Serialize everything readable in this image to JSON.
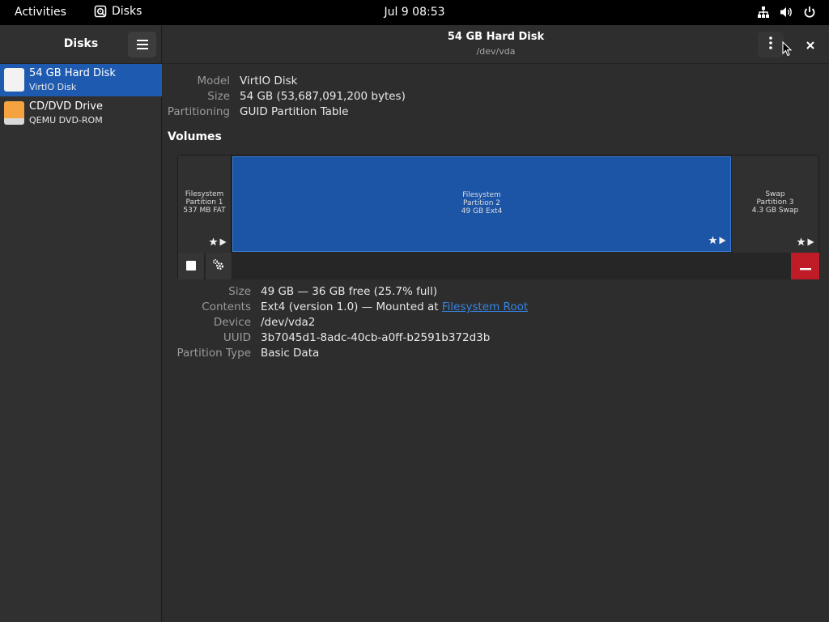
{
  "topbar": {
    "activities": "Activities",
    "app_name": "Disks",
    "clock": "Jul 9  08:53"
  },
  "sidebar": {
    "title": "Disks",
    "items": [
      {
        "name": "54 GB Hard Disk",
        "sub": "VirtIO Disk",
        "icon": "hard-disk-icon",
        "selected": true
      },
      {
        "name": "CD/DVD Drive",
        "sub": "QEMU DVD-ROM",
        "icon": "optical-drive-icon",
        "selected": false
      }
    ]
  },
  "header": {
    "title": "54 GB Hard Disk",
    "subtitle": "/dev/vda"
  },
  "drive_props": {
    "model_label": "Model",
    "model": "VirtIO Disk",
    "size_label": "Size",
    "size": "54 GB (53,687,091,200 bytes)",
    "partitioning_label": "Partitioning",
    "partitioning": "GUID Partition Table"
  },
  "volumes": {
    "title": "Volumes",
    "partitions": [
      {
        "line1": "Filesystem",
        "line2": "Partition 1",
        "line3": "537 MB FAT",
        "selected": false
      },
      {
        "line1": "Filesystem",
        "line2": "Partition 2",
        "line3": "49 GB Ext4",
        "selected": true
      },
      {
        "line1": "Swap",
        "line2": "Partition 3",
        "line3": "4.3 GB Swap",
        "selected": false
      }
    ]
  },
  "volume_props": {
    "size_label": "Size",
    "size": "49 GB — 36 GB free (25.7% full)",
    "contents_label": "Contents",
    "contents_prefix": "Ext4 (version 1.0) — Mounted at ",
    "contents_link": "Filesystem Root",
    "device_label": "Device",
    "device": "/dev/vda2",
    "uuid_label": "UUID",
    "uuid": "3b7045d1-8adc-40cb-a0ff-b2591b372d3b",
    "ptype_label": "Partition Type",
    "ptype": "Basic Data"
  },
  "colors": {
    "selection": "#1e5bb0",
    "partition_selected": "#1d55a6",
    "danger": "#c01c28",
    "link": "#3584e4",
    "optical_icon": "#f5a340"
  }
}
